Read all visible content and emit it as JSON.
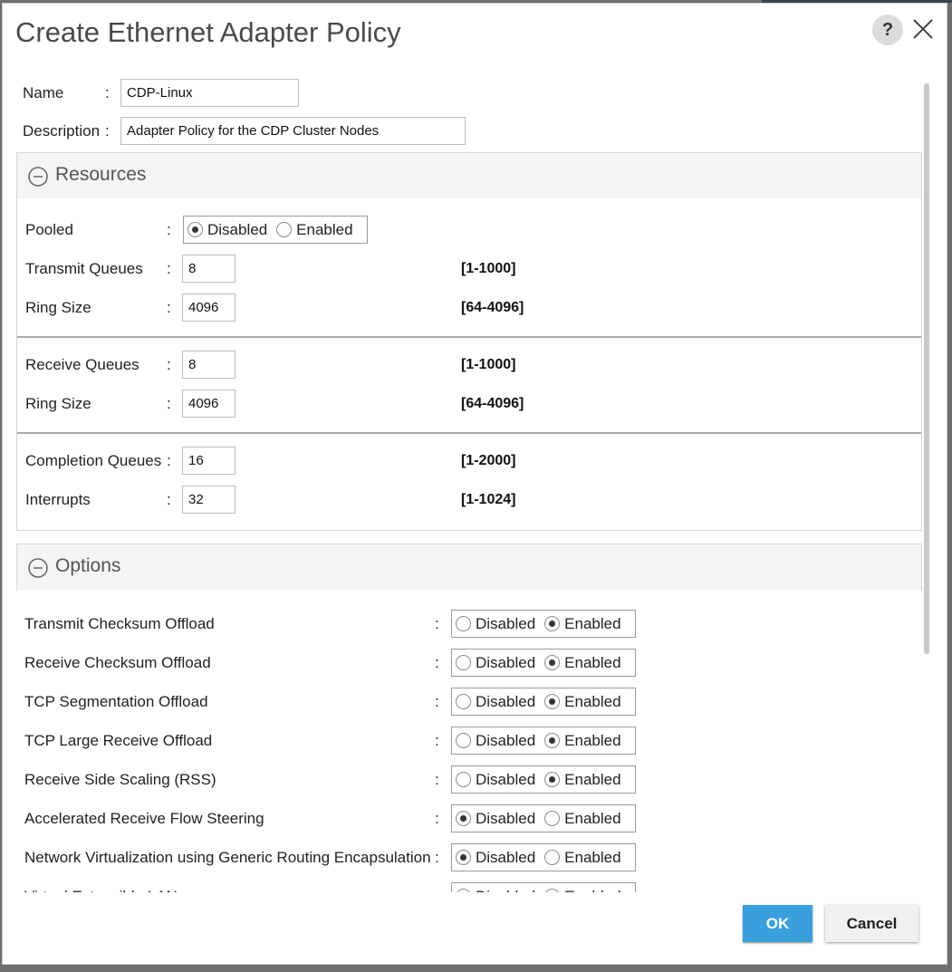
{
  "dialog": {
    "title": "Create Ethernet Adapter Policy",
    "help_label": "?",
    "ok_label": "OK",
    "cancel_label": "Cancel"
  },
  "general": {
    "name_label": "Name",
    "name_value": "CDP-Linux",
    "description_label": "Description",
    "description_value": "Adapter Policy for the CDP Cluster Nodes",
    "colon": ":"
  },
  "resources": {
    "title": "Resources",
    "pooled": {
      "label": "Pooled",
      "options": [
        "Disabled",
        "Enabled"
      ],
      "selected": "Disabled"
    },
    "rows": [
      {
        "label": "Transmit Queues",
        "value": "8",
        "range": "[1-1000]"
      },
      {
        "label": "Ring Size",
        "value": "4096",
        "range": "[64-4096]"
      },
      {
        "label": "Receive Queues",
        "value": "8",
        "range": "[1-1000]"
      },
      {
        "label": "Ring Size",
        "value": "4096",
        "range": "[64-4096]"
      },
      {
        "label": "Completion Queues",
        "value": "16",
        "range": "[1-2000]"
      },
      {
        "label": "Interrupts",
        "value": "32",
        "range": "[1-1024]"
      }
    ]
  },
  "options": {
    "title": "Options",
    "radio_labels": [
      "Disabled",
      "Enabled"
    ],
    "rows": [
      {
        "label": "Transmit Checksum Offload",
        "selected": "Enabled"
      },
      {
        "label": "Receive Checksum Offload",
        "selected": "Enabled"
      },
      {
        "label": "TCP Segmentation Offload",
        "selected": "Enabled"
      },
      {
        "label": "TCP Large Receive Offload",
        "selected": "Enabled"
      },
      {
        "label": "Receive Side Scaling (RSS)",
        "selected": "Enabled"
      },
      {
        "label": "Accelerated Receive Flow Steering",
        "selected": "Disabled"
      },
      {
        "label": "Network Virtualization using Generic Routing Encapsulation",
        "selected": "Disabled"
      },
      {
        "label": "Virtual Extensible LAN",
        "selected": "Disabled"
      }
    ]
  }
}
